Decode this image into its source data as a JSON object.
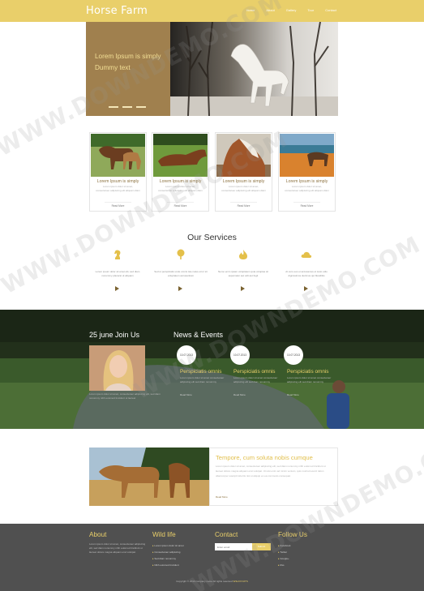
{
  "header": {
    "logo": "Horse Farm",
    "nav": [
      "Home",
      "About",
      "Gallery",
      "Tour",
      "Contact"
    ]
  },
  "hero": {
    "text": "Lorem Ipsum is simply Dummy text",
    "slide_count": 3
  },
  "cards": [
    {
      "title": "Lorem Ipsum is simply",
      "text": "Lorem ipsum dolor sit amet, consectetuer adipiscing elit aliquam diam",
      "more": "Read More"
    },
    {
      "title": "Lorem Ipsum is simply",
      "text": "Lorem ipsum dolor sit amet, consectetuer adipiscing elit aliquam diam",
      "more": "Read More"
    },
    {
      "title": "Lorem Ipsum is simply",
      "text": "Lorem ipsum dolor sit amet, consectetuer adipiscing elit aliquam diam",
      "more": "Read More"
    },
    {
      "title": "Lorem Ipsum is simply",
      "text": "Lorem ipsum dolor sit amet, consectetuer adipiscing elit aliquam diam",
      "more": "Read More"
    }
  ],
  "services": {
    "title": "Our Services",
    "items": [
      {
        "icon": "horse-chess-icon",
        "text": "Lorem ipsum dolor sit amet elit, sed diam nonummy placerat ut aliquam"
      },
      {
        "icon": "tree-icon",
        "text": "Sed ut perspiciatis unde omnis iste natus error sit voluptatem accusantium"
      },
      {
        "icon": "fire-icon",
        "text": "Nemo enim ipsam voluptatem quia voluptas sit aspernatur aut odit aut fugit"
      },
      {
        "icon": "cloud-icon",
        "text": "At vero eos et accusamus et iusto odio dignissimos ducimus qui blanditiis"
      }
    ]
  },
  "join": {
    "title": "25 june Join Us",
    "text": "Lorem ipsum dolor sit amet, consectetuer adipiscing elit, sed diam nonummy nibh euismod tincidunt ut laoreet"
  },
  "news": {
    "title": "News & Events",
    "items": [
      {
        "date": "10.07.2013",
        "title": "Perspiciatis omnis",
        "text": "Lorem ipsum dolor sit amet consectetuer adipiscing elit sed diam nonummy",
        "more": "Read More"
      },
      {
        "date": "10.07.2013",
        "title": "Perspiciatis omnis",
        "text": "Lorem ipsum dolor sit amet consectetuer adipiscing elit sed diam nonummy",
        "more": "Read More"
      },
      {
        "date": "10.07.2013",
        "title": "Perspiciatis omnis",
        "text": "Lorem ipsum dolor sit amet consectetuer adipiscing elit sed diam nonummy",
        "more": "Read More"
      }
    ]
  },
  "about": {
    "title": "Tempore, cum soluta nobis cumque",
    "text": "Lorem ipsum dolor sit amet, consectetuer adipiscing elit, sed diam nonummy nibh euismod tincidunt ut laoreet dolore magna aliquam erat volutpat. Ut wisi enim ad minim veniam, quis nostrud exerci tation ullamcorper suscipit lobortis nisl ut aliquip ex ea commodo consequat.",
    "more": "Read More"
  },
  "footer": {
    "about": {
      "title": "About",
      "text": "Lorem ipsum dolor sit amet, consectetuer adipiscing elit, sed diam nonummy nibh euismod tincidunt ut laoreet dolore magna aliquam erat volutpat."
    },
    "wild": {
      "title": "Wild life",
      "items": [
        "Lorem ipsum dolor sit amet",
        "Consectetuer adipiscing",
        "Sed diam nonummy",
        "Nibh euismod tincidunt"
      ]
    },
    "contact": {
      "title": "Contact",
      "input_placeholder": "Enter email",
      "button": "Submit"
    },
    "follow": {
      "title": "Follow Us",
      "items": [
        "Facebook",
        "Twitter",
        "Google+",
        "Rss"
      ]
    },
    "copyright_prefix": "Copyright © 2013 company name All rights reserved",
    "copyright_brand": "W3LAYOUTS"
  },
  "watermark": "WWW.DOWNDEMO.COM",
  "colors": {
    "accent": "#e9cf6a",
    "brown": "#a0804e",
    "dark": "#505050"
  }
}
